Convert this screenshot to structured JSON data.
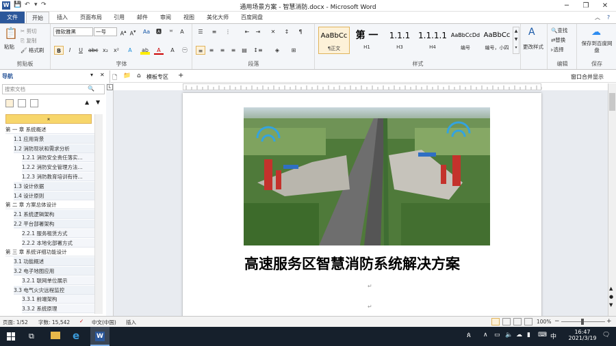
{
  "window": {
    "title": "通用场景方案 - 智慧消防.docx - Microsoft Word",
    "controls": [
      "─",
      "❐",
      "✕"
    ]
  },
  "ribbon_tabs": [
    "文件",
    "开始",
    "插入",
    "页面布局",
    "引用",
    "邮件",
    "审阅",
    "视图",
    "美化大师",
    "百度网盘"
  ],
  "clipboard": {
    "paste": "粘贴",
    "cut": "剪切",
    "copy": "复制",
    "format_painter": "格式刷",
    "label": "剪贴板"
  },
  "font": {
    "name": "微软雅黑",
    "size": "一号",
    "label": "字体"
  },
  "paragraph": {
    "label": "段落"
  },
  "styles": {
    "items": [
      {
        "preview": "AaBbCc",
        "name": "¶正文"
      },
      {
        "preview": "第 一",
        "name": "H1"
      },
      {
        "preview": "1.1.1",
        "name": "H3"
      },
      {
        "preview": "1.1.1.1",
        "name": "H4"
      },
      {
        "preview": "AaBbCcDd",
        "name": "编号"
      },
      {
        "preview": "AaBbCc",
        "name": "编号，小四"
      }
    ],
    "change": "更改样式",
    "label": "样式"
  },
  "editing": {
    "find": "查找",
    "replace": "替换",
    "select": "选择",
    "label": "编辑"
  },
  "save_group": {
    "save": "保存到百度网盘",
    "label": "保存"
  },
  "nav": {
    "title": "导航",
    "search_placeholder": "搜索文档",
    "items": [
      {
        "level": 1,
        "text": "第 一 章  系统概述"
      },
      {
        "level": 2,
        "text": "1.1  应用背景"
      },
      {
        "level": 2,
        "text": "1.2  消防现状和需求分析"
      },
      {
        "level": 3,
        "text": "1.2.1  消防安全责任落实..."
      },
      {
        "level": 3,
        "text": "1.2.2  消防安全管理方法..."
      },
      {
        "level": 3,
        "text": "1.2.3  消防教育培训有待..."
      },
      {
        "level": 2,
        "text": "1.3  设计依据"
      },
      {
        "level": 2,
        "text": "1.4  设计原则"
      },
      {
        "level": 1,
        "text": "第 二 章  方案总体设计"
      },
      {
        "level": 2,
        "text": "2.1  系统逻辑架构"
      },
      {
        "level": 2,
        "text": "2.2  平台部署架构"
      },
      {
        "level": 3,
        "text": "2.2.1  服务租赁方式"
      },
      {
        "level": 3,
        "text": "2.2.2  本地化部署方式"
      },
      {
        "level": 1,
        "text": "第 三 章  系统详细功能设计"
      },
      {
        "level": 2,
        "text": "3.1  功能概述"
      },
      {
        "level": 2,
        "text": "3.2  电子地图应用"
      },
      {
        "level": 3,
        "text": "3.2.1  联网单位展示"
      },
      {
        "level": 2,
        "text": "3.3  电气火灾远程监控"
      },
      {
        "level": 3,
        "text": "3.3.1  前端架构"
      },
      {
        "level": 3,
        "text": "3.3.2  系统原理"
      }
    ]
  },
  "doc_tabs": {
    "template": "模板专区",
    "add": "+",
    "window_option": "窗口合并显示"
  },
  "document": {
    "title": "高速服务区智慧消防系统解决方案"
  },
  "status": {
    "page": "页面: 1/52",
    "words": "字数: 15,542",
    "language": "中文(中国)",
    "mode": "插入",
    "zoom": "100%"
  },
  "taskbar": {
    "time": "16:47",
    "date": "2021/3/19",
    "ime": "中"
  }
}
